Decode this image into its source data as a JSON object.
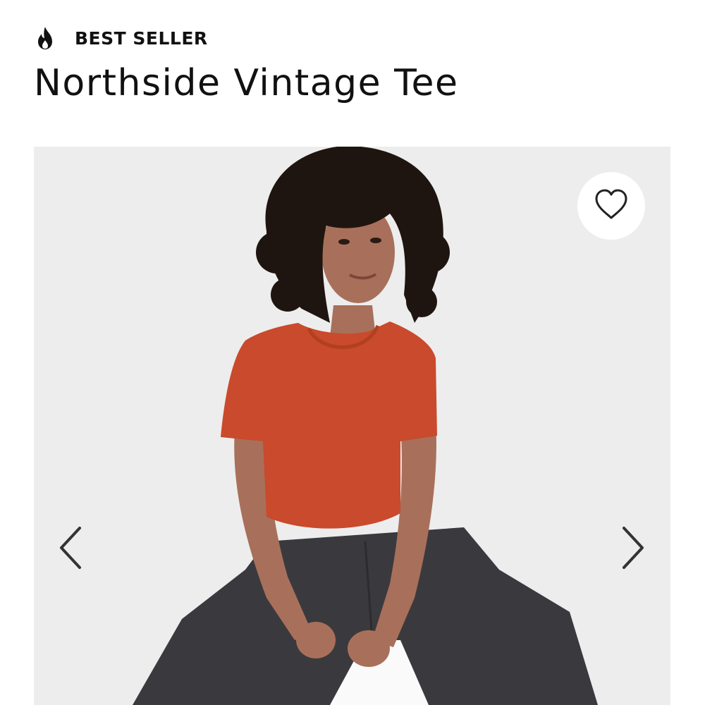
{
  "badge": {
    "label": "BEST SELLER",
    "icon": "flame-icon"
  },
  "product": {
    "title": "Northside Vintage Tee"
  },
  "gallery": {
    "favorite_icon": "heart-outline-icon",
    "prev_icon": "chevron-left-icon",
    "next_icon": "chevron-right-icon"
  },
  "colors": {
    "text": "#111111",
    "gallery_background": "#ededed",
    "tee": "#c94a2c",
    "jeans": "#3a3a3e",
    "hair": "#1f1510",
    "skin": "#a8705a"
  }
}
